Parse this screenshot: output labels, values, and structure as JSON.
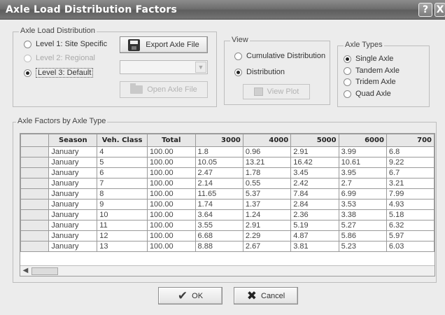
{
  "window": {
    "title": "Axle Load Distribution Factors",
    "help_button": "?",
    "close_button": "X"
  },
  "axle_load_distribution": {
    "legend": "Axle Load Distribution",
    "options": [
      {
        "label": "Level 1: Site Specific",
        "selected": false,
        "enabled": true
      },
      {
        "label": "Level 2: Regional",
        "selected": false,
        "enabled": false
      },
      {
        "label": "Level 3: Default",
        "selected": true,
        "enabled": true
      }
    ],
    "export_button": "Export Axle File",
    "open_button": "Open Axle File",
    "combo_value": ""
  },
  "view": {
    "legend": "View",
    "options": [
      {
        "label": "Cumulative Distribution",
        "selected": false
      },
      {
        "label": "Distribution",
        "selected": true
      }
    ],
    "view_plot_button": "View Plot"
  },
  "axle_types": {
    "legend": "Axle Types",
    "options": [
      {
        "label": "Single Axle",
        "selected": true
      },
      {
        "label": "Tandem Axle",
        "selected": false
      },
      {
        "label": "Tridem Axle",
        "selected": false
      },
      {
        "label": "Quad Axle",
        "selected": false
      }
    ]
  },
  "factors": {
    "legend": "Axle Factors by Axle Type",
    "columns": [
      "Season",
      "Veh. Class",
      "Total",
      "3000",
      "4000",
      "5000",
      "6000",
      "700"
    ],
    "rows": [
      [
        "January",
        "4",
        "100.00",
        "1.8",
        "0.96",
        "2.91",
        "3.99",
        "6.8"
      ],
      [
        "January",
        "5",
        "100.00",
        "10.05",
        "13.21",
        "16.42",
        "10.61",
        "9.22"
      ],
      [
        "January",
        "6",
        "100.00",
        "2.47",
        "1.78",
        "3.45",
        "3.95",
        "6.7"
      ],
      [
        "January",
        "7",
        "100.00",
        "2.14",
        "0.55",
        "2.42",
        "2.7",
        "3.21"
      ],
      [
        "January",
        "8",
        "100.00",
        "11.65",
        "5.37",
        "7.84",
        "6.99",
        "7.99"
      ],
      [
        "January",
        "9",
        "100.00",
        "1.74",
        "1.37",
        "2.84",
        "3.53",
        "4.93"
      ],
      [
        "January",
        "10",
        "100.00",
        "3.64",
        "1.24",
        "2.36",
        "3.38",
        "5.18"
      ],
      [
        "January",
        "11",
        "100.00",
        "3.55",
        "2.91",
        "5.19",
        "5.27",
        "6.32"
      ],
      [
        "January",
        "12",
        "100.00",
        "6.68",
        "2.29",
        "4.87",
        "5.86",
        "5.97"
      ],
      [
        "January",
        "13",
        "100.00",
        "8.88",
        "2.67",
        "3.81",
        "5.23",
        "6.03"
      ]
    ]
  },
  "footer": {
    "ok_button": "OK",
    "cancel_button": "Cancel"
  }
}
